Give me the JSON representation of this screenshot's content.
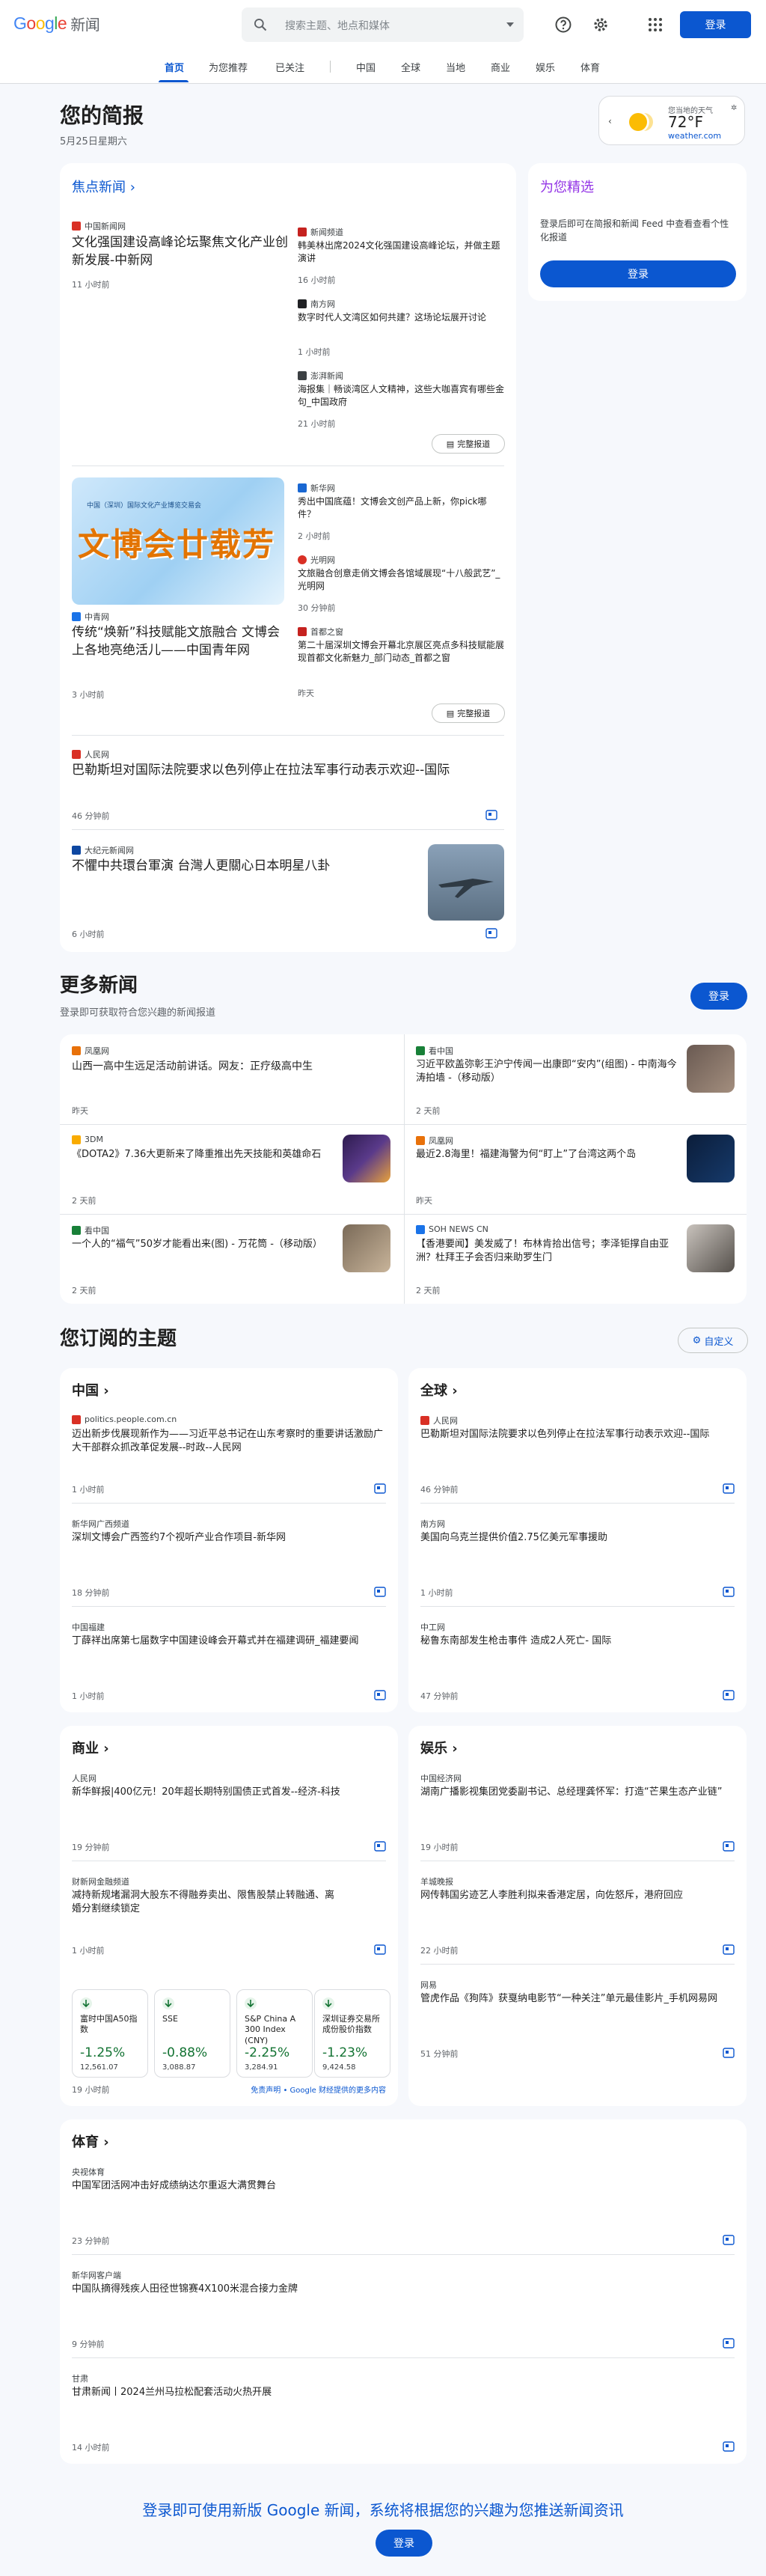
{
  "header": {
    "logo": "Google",
    "app": "新闻",
    "search_placeholder": "搜索主题、地点和媒体",
    "signin": "登录",
    "icons": [
      "search-icon",
      "chevron-down-icon",
      "help-icon",
      "settings-icon",
      "apps-icon"
    ]
  },
  "nav": {
    "items": [
      "首页",
      "为您推荐",
      "已关注",
      "中国",
      "全球",
      "当地",
      "商业",
      "娱乐",
      "体育"
    ],
    "active": "首页"
  },
  "briefing": {
    "title": "您的简报",
    "date": "5月25日星期六"
  },
  "weather": {
    "label": "您当地的天气",
    "temp": "72°F",
    "source": "weather.com"
  },
  "top": {
    "link": "焦点新闻",
    "full_coverage": "完整报道",
    "cluster1": {
      "main": {
        "source": "中国新闻网",
        "title": "文化强国建设高峰论坛聚焦文化产业创新发展-中新网",
        "time": "11 小时前"
      },
      "side": [
        {
          "source": "新闻频道",
          "title": "韩美林出席2024文化强国建设高峰论坛，并做主题演讲",
          "time": "16 小时前"
        },
        {
          "source": "南方网",
          "title": "数字时代人文湾区如何共建？这场论坛展开讨论",
          "time": "1 小时前"
        },
        {
          "source": "澎湃新闻",
          "title": "海报集｜畅谈湾区人文精神，这些大咖喜宾有哪些金句_中国政府",
          "time": "21 小时前"
        }
      ]
    },
    "cluster2": {
      "banner": "文博会廿载芳",
      "banner_top": "中国（深圳）国际文化产业博览交易会",
      "main": {
        "source": "中青网",
        "title": "传统“焕新”科技赋能文旅融合 文博会上各地亮绝活儿——中国青年网",
        "time": "3 小时前"
      },
      "side": [
        {
          "source": "新华网",
          "title": "秀出中国底蕴！文博会文创产品上新，你pick哪件？",
          "time": "2 小时前"
        },
        {
          "source": "光明网",
          "title": "文旅融合创意走俏文博会各馆域展现“十八般武艺”_光明网",
          "time": "30 分钟前"
        },
        {
          "source": "首都之窗",
          "title": "第二十届深圳文博会开幕北京展区亮点多科技赋能展现首都文化新魅力_部门动态_首都之窗",
          "time": "昨天"
        }
      ]
    },
    "story3": {
      "source": "人民网",
      "title": "巴勒斯坦对国际法院要求以色列停止在拉法军事行动表示欢迎--国际",
      "time": "46 分钟前"
    },
    "story4": {
      "source": "大纪元新闻网",
      "title": "不懼中共環台軍演 台灣人更關心日本明星八卦",
      "time": "6 小时前"
    }
  },
  "picks": {
    "title": "为您精选",
    "text": "登录后即可在简报和新闻 Feed 中查看查看个性化报道",
    "signin": "登录"
  },
  "more": {
    "title": "更多新闻",
    "sub": "登录即可获取符合您兴趣的新闻报道",
    "signin": "登录",
    "items": [
      {
        "source": "凤凰网",
        "title": "山西一高中生远足活动前讲话。网友：正疗级高中生",
        "time": "昨天"
      },
      {
        "source": "看中国",
        "title": "习近平欧盖弥彰王沪宁传闻一出康即“安内”(组图) - 中南海今涛拍墙 -（移动版）",
        "time": "2 天前"
      },
      {
        "source": "3DM",
        "title": "《DOTA2》7.36大更新来了降重推出先天技能和英雄命石",
        "time": "2 天前"
      },
      {
        "source": "凤凰网",
        "title": "最近2.8海里！福建海警为何“盯上”了台湾这两个岛",
        "time": "昨天"
      },
      {
        "source": "看中国",
        "title": "一个人的“福气”50岁才能看出来(图) - 万花筒 -（移动版）",
        "time": "2 天前"
      },
      {
        "source": "SOH NEWS CN",
        "title": "【香港要闻】美发威了！布林肯拾出信号；李泽钜撑自由亚洲？杜拜王子会否归来助罗生门",
        "time": "2 天前"
      }
    ]
  },
  "topics": {
    "title": "您订阅的主题",
    "customize": "自定义",
    "china": {
      "title": "中国",
      "items": [
        {
          "source": "politics.people.com.cn",
          "title": "迈出新步伐展现新作为——习近平总书记在山东考察时的重要讲话激励广大干部群众抓改革促发展--时政--人民网",
          "time": "1 小时前"
        },
        {
          "source": "新华网广西频道",
          "title": "深圳文博会广西签约7个视听产业合作项目-新华网",
          "time": "18 分钟前"
        },
        {
          "source": "中国福建",
          "title": "丁薛祥出席第七届数字中国建设峰会开幕式并在福建调研_福建要闻",
          "time": "1 小时前"
        }
      ]
    },
    "world": {
      "title": "全球",
      "items": [
        {
          "source": "人民网",
          "title": "巴勒斯坦对国际法院要求以色列停止在拉法军事行动表示欢迎--国际",
          "time": "46 分钟前"
        },
        {
          "source": "南方网",
          "title": "美国向乌克兰提供价值2.75亿美元军事援助",
          "time": "1 小时前"
        },
        {
          "source": "中工网",
          "title": "秘鲁东南部发生枪击事件 造成2人死亡- 国际",
          "time": "47 分钟前"
        }
      ]
    },
    "business": {
      "title": "商业",
      "items": [
        {
          "source": "人民网",
          "title": "新华鲜报|400亿元！20年超长期特别国债正式首发--经济-科技",
          "time": "19 分钟前"
        },
        {
          "source": "财新网金融频道",
          "title": "减持新规堵漏洞大股东不得融券卖出、限售股禁止转融通、离婚分割继续锁定",
          "time": "1 小时前"
        }
      ],
      "stocks": [
        {
          "name": "富时中国A50指数",
          "pct": "-1.25%",
          "val": "12,561.07"
        },
        {
          "name": "SSE",
          "pct": "-0.88%",
          "val": "3,088.87"
        },
        {
          "name": "S&P China A 300 Index (CNY)",
          "pct": "-2.25%",
          "val": "3,284.91"
        },
        {
          "name": "深圳证券交易所成份股价指数",
          "pct": "-1.23%",
          "val": "9,424.58"
        }
      ],
      "stocks_time": "19 小时前",
      "disclaimer": "免责声明 • Google 财经提供的更多内容"
    },
    "ent": {
      "title": "娱乐",
      "items": [
        {
          "source": "中国经济网",
          "title": "湖南广播影视集团党委副书记、总经理龚怀军：打造“芒果生态产业链”",
          "time": "19 小时前"
        },
        {
          "source": "羊城晚报",
          "title": "网传韩国劣迹艺人李胜利拟来香港定居，向佐怒斥，港府回应",
          "time": "22 小时前"
        },
        {
          "source": "网易",
          "title": "管虎作品《狗阵》获戛纳电影节“一种关注”单元最佳影片_手机网易网",
          "time": "51 分钟前"
        }
      ]
    },
    "sports": {
      "title": "体育",
      "items": [
        {
          "source": "央视体育",
          "title": "中国军团活网冲击好成绩纳达尔重返大满贯舞台",
          "time": "23 分钟前"
        },
        {
          "source": "新华网客户端",
          "title": "中国队摘得残疾人田径世锦赛4X100米混合接力金牌",
          "time": "9 分钟前"
        },
        {
          "source": "甘肃",
          "title": "甘肃新闻丨2024兰州马拉松配套活动火热开展",
          "time": "14 小时前"
        }
      ]
    }
  },
  "footer": {
    "text": "登录即可使用新版 Google 新闻，系统将根据您的兴趣为您推送新闻资讯",
    "signin": "登录"
  }
}
